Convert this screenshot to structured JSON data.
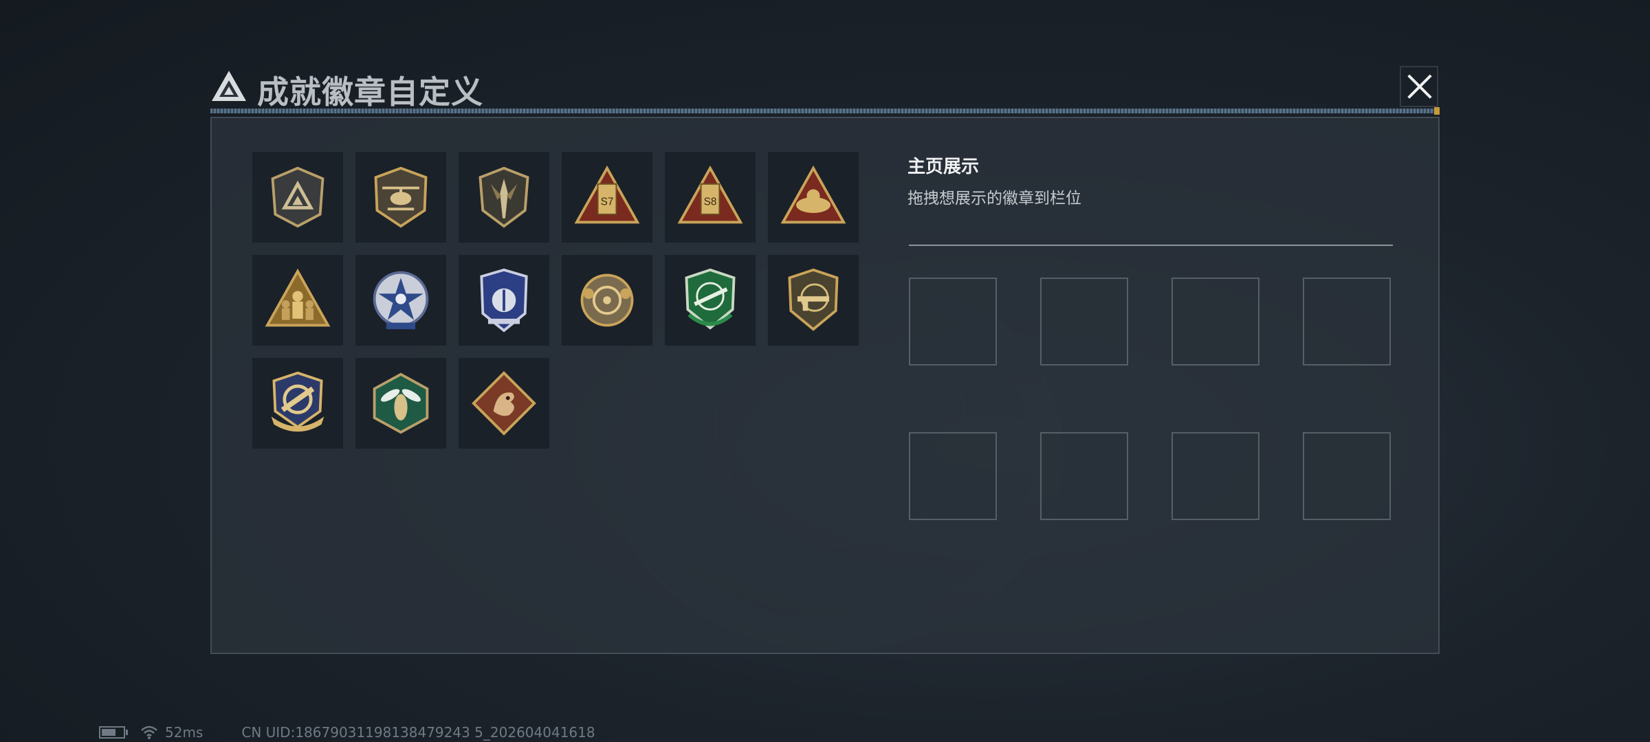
{
  "header": {
    "title": "成就徽章自定义",
    "logo_icon": "triangle-logo-icon",
    "close_icon": "close-icon"
  },
  "badges": [
    {
      "icon": "shield-triangle-badge-icon"
    },
    {
      "icon": "helicopter-badge-icon"
    },
    {
      "icon": "dagger-shield-badge-icon"
    },
    {
      "icon": "s7-triangle-badge-icon",
      "label": "S7"
    },
    {
      "icon": "s8-triangle-badge-icon",
      "label": "S8"
    },
    {
      "icon": "sunrise-triangle-badge-icon"
    },
    {
      "icon": "squad-triangle-badge-icon"
    },
    {
      "icon": "star-badge-icon"
    },
    {
      "icon": "police-shield-badge-icon"
    },
    {
      "icon": "skull-crosshair-badge-icon"
    },
    {
      "icon": "green-rifle-badge-icon"
    },
    {
      "icon": "gold-gun-badge-icon"
    },
    {
      "icon": "crosshair-wings-badge-icon"
    },
    {
      "icon": "hornet-hexagon-badge-icon"
    },
    {
      "icon": "dragon-diamond-badge-icon"
    }
  ],
  "showcase": {
    "title": "主页展示",
    "subtitle": "拖拽想展示的徽章到栏位",
    "slot_count": 8
  },
  "status_bar": {
    "battery_icon": "battery-icon",
    "wifi_icon": "wifi-icon",
    "ping": "52ms",
    "uid": "CN UID:18679031198138479243 5_202604041618"
  },
  "colors": {
    "gold": "#c9a45a",
    "panel": "#2a323b",
    "accent_line": "#6f8ea8"
  }
}
